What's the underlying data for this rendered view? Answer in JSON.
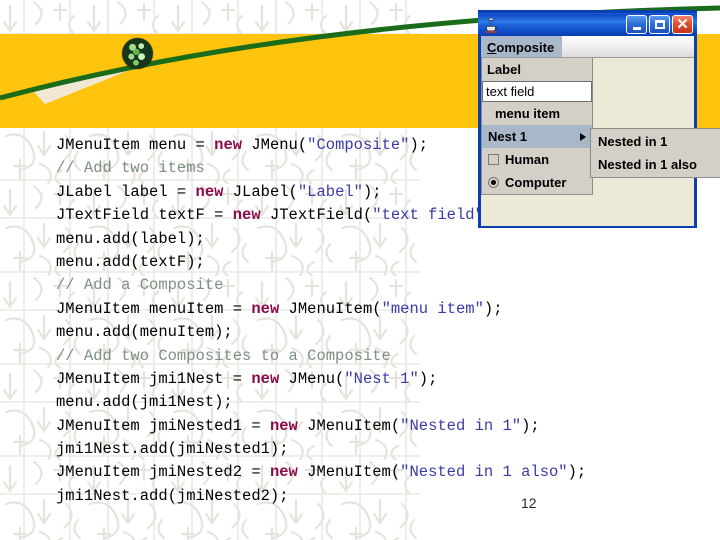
{
  "slide": {
    "page_number": "12",
    "accent_band_color": "#FFC40D",
    "curve_color": "#1A6B1A"
  },
  "code": {
    "lines": [
      [
        {
          "t": "JMenuItem menu = ",
          "c": "plain"
        },
        {
          "t": "new",
          "c": "kw"
        },
        {
          "t": " JMenu(",
          "c": "plain"
        },
        {
          "t": "\"Composite\"",
          "c": "str"
        },
        {
          "t": ");",
          "c": "plain"
        }
      ],
      [
        {
          "t": "// Add two items",
          "c": "cmt"
        }
      ],
      [
        {
          "t": "JLabel label = ",
          "c": "plain"
        },
        {
          "t": "new",
          "c": "kw"
        },
        {
          "t": " JLabel(",
          "c": "plain"
        },
        {
          "t": "\"Label\"",
          "c": "str"
        },
        {
          "t": ");",
          "c": "plain"
        }
      ],
      [
        {
          "t": "JTextField textF = ",
          "c": "plain"
        },
        {
          "t": "new",
          "c": "kw"
        },
        {
          "t": " JTextField(",
          "c": "plain"
        },
        {
          "t": "\"text field\"",
          "c": "str"
        },
        {
          "t": ");",
          "c": "plain"
        }
      ],
      [
        {
          "t": "menu.add(label);",
          "c": "plain"
        }
      ],
      [
        {
          "t": "menu.add(textF);",
          "c": "plain"
        }
      ],
      [
        {
          "t": "// Add a Composite",
          "c": "cmt"
        }
      ],
      [
        {
          "t": "JMenuItem menuItem = ",
          "c": "plain"
        },
        {
          "t": "new",
          "c": "kw"
        },
        {
          "t": " JMenuItem(",
          "c": "plain"
        },
        {
          "t": "\"menu item\"",
          "c": "str"
        },
        {
          "t": ");",
          "c": "plain"
        }
      ],
      [
        {
          "t": "menu.add(menuItem);",
          "c": "plain"
        }
      ],
      [
        {
          "t": "// Add two Composites to a Composite",
          "c": "cmt"
        }
      ],
      [
        {
          "t": "JMenuItem jmi1Nest = ",
          "c": "plain"
        },
        {
          "t": "new",
          "c": "kw"
        },
        {
          "t": " JMenu(",
          "c": "plain"
        },
        {
          "t": "\"Nest 1\"",
          "c": "str"
        },
        {
          "t": ");",
          "c": "plain"
        }
      ],
      [
        {
          "t": "menu.add(jmi1Nest);",
          "c": "plain"
        }
      ],
      [
        {
          "t": "JMenuItem jmiNested1 = ",
          "c": "plain"
        },
        {
          "t": "new",
          "c": "kw"
        },
        {
          "t": " JMenuItem(",
          "c": "plain"
        },
        {
          "t": "\"Nested in 1\"",
          "c": "str"
        },
        {
          "t": ");",
          "c": "plain"
        }
      ],
      [
        {
          "t": "jmi1Nest.add(jmiNested1);",
          "c": "plain"
        }
      ],
      [
        {
          "t": "JMenuItem jmiNested2 = ",
          "c": "plain"
        },
        {
          "t": "new",
          "c": "kw"
        },
        {
          "t": " JMenuItem(",
          "c": "plain"
        },
        {
          "t": "\"Nested in 1 also\"",
          "c": "str"
        },
        {
          "t": ");",
          "c": "plain"
        }
      ],
      [
        {
          "t": "jmi1Nest.add(jmiNested2);",
          "c": "plain"
        }
      ]
    ]
  },
  "app_window": {
    "title": "",
    "title_icon": "java-coffee-cup-icon",
    "buttons": {
      "minimize": "minimize-icon",
      "maximize": "maximize-icon",
      "close": "close-icon"
    },
    "menu_bar": {
      "menu_label": "Composite",
      "mnemonic": "C"
    },
    "dropdown": {
      "label_item": "Label",
      "textfield_value": "text field",
      "menu_item": "menu item",
      "nest_item": "Nest 1",
      "checkbox_item": {
        "label": "Human",
        "checked": false
      },
      "radio_item": {
        "label": "Computer",
        "checked": true
      }
    },
    "submenu": {
      "items": [
        "Nested in 1",
        "Nested in 1 also"
      ]
    }
  }
}
